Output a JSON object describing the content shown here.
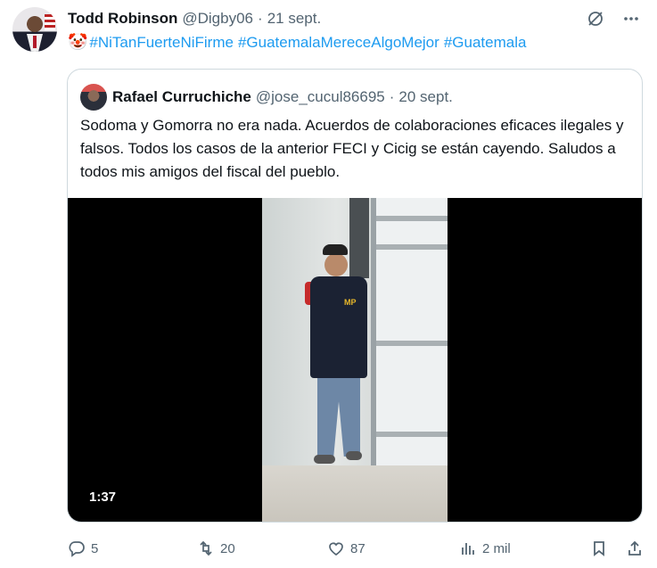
{
  "tweet": {
    "author_name": "Todd Robinson",
    "author_handle": "@Digby06",
    "separator": "·",
    "date": "21 sept.",
    "emoji": "🤡",
    "hashtags": [
      "#NiTanFuerteNiFirme",
      "#GuatemalaMereceAlgoMejor",
      "#Guatemala"
    ]
  },
  "quote": {
    "author_name": "Rafael Curruchiche",
    "author_handle": "@jose_cucul86695",
    "separator": "·",
    "date": "20 sept.",
    "text": "Sodoma y Gomorra no era nada. Acuerdos de colaboraciones eficaces ilegales y falsos. Todos los casos de la anterior FECI y Cicig se están cayendo. Saludos a todos mis amigos del fiscal del pueblo.",
    "video": {
      "duration": "1:37",
      "vest_logo": "MP"
    }
  },
  "actions": {
    "replies": "5",
    "retweets": "20",
    "likes": "87",
    "views": "2 mil"
  },
  "icons": [
    "grok-icon",
    "more-icon",
    "reply-icon",
    "retweet-icon",
    "like-icon",
    "views-icon",
    "bookmark-icon",
    "share-icon"
  ]
}
